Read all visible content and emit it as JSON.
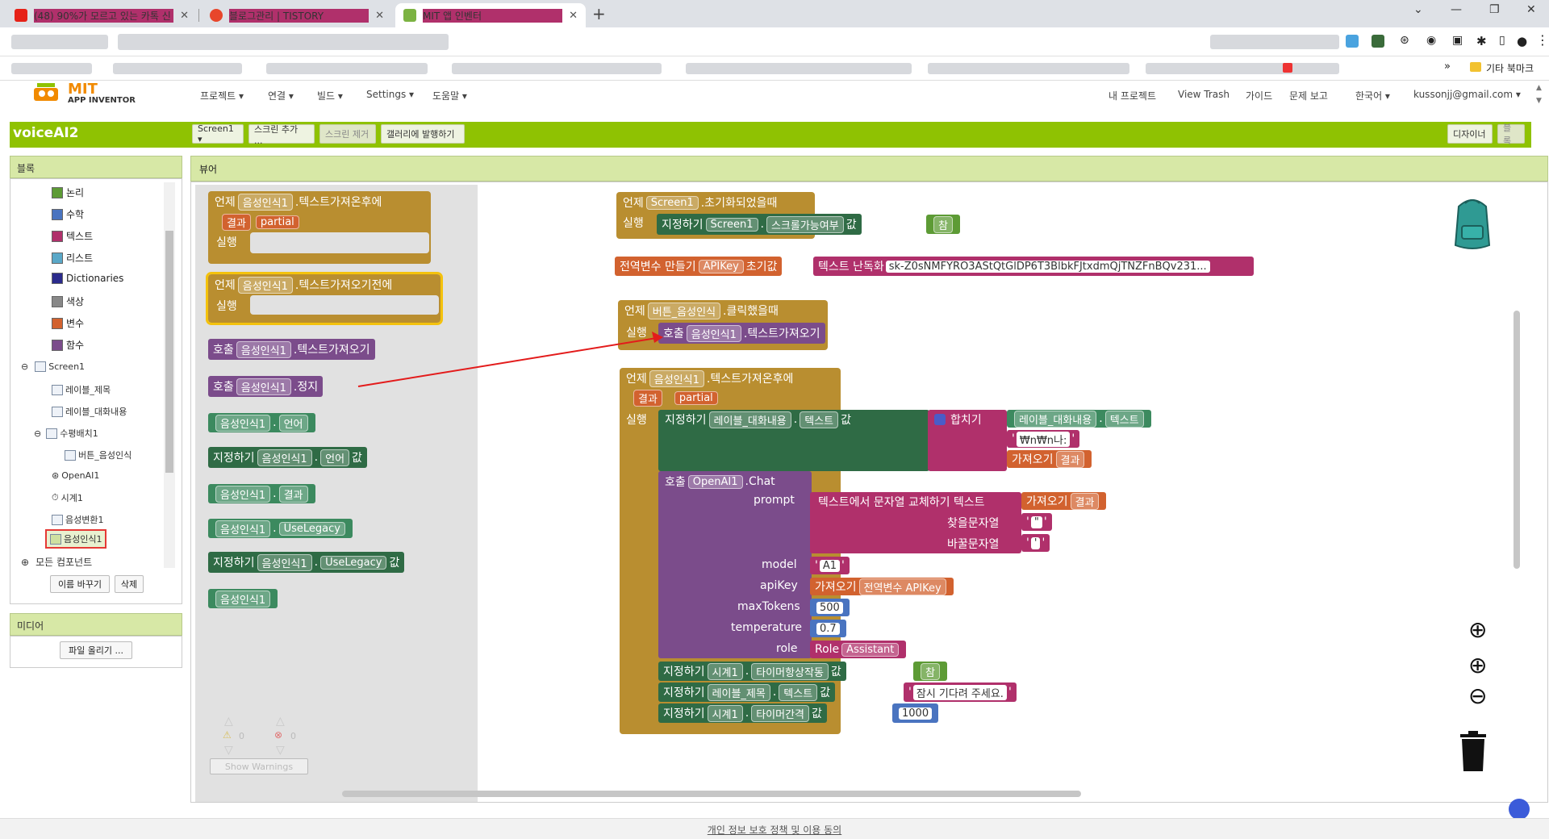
{
  "browser": {
    "tabs": [
      {
        "title": "(48) 90%가 모르고 있는 카톡 신",
        "icon": "youtube-icon"
      },
      {
        "title": "블로그관리 | TISTORY",
        "icon": "tistory-icon"
      },
      {
        "title": "MIT 앱 인벤터",
        "icon": "mit-icon"
      }
    ],
    "bookmarks_other": "기타 북마크",
    "bookmarks_more": "»"
  },
  "app": {
    "logo_line1": "MIT",
    "logo_line2": "APP INVENTOR",
    "menus": [
      "프로젝트 ▾",
      "연결 ▾",
      "빌드 ▾",
      "Settings ▾",
      "도움말 ▾"
    ],
    "right_menus": [
      "내 프로젝트",
      "View Trash",
      "가이드",
      "문제 보고",
      "한국어 ▾",
      "kussonjj@gmail.com ▾"
    ],
    "project_name": "voiceAI2",
    "toolbar": {
      "screen": "Screen1 ▾",
      "add_screen": "스크린 추가 ...",
      "remove_screen": "스크린 제거",
      "publish": "갤러리에 발행하기",
      "designer": "디자이너",
      "blocks": "블록"
    }
  },
  "blocks_panel": {
    "title": "블록",
    "builtins": [
      {
        "label": "논리",
        "color": "#5d9b35"
      },
      {
        "label": "수학",
        "color": "#4a74c0"
      },
      {
        "label": "텍스트",
        "color": "#b0306b"
      },
      {
        "label": "리스트",
        "color": "#5aa8c8"
      },
      {
        "label": "Dictionaries",
        "color": "#2b2b8c"
      },
      {
        "label": "색상",
        "color": "#888888"
      },
      {
        "label": "변수",
        "color": "#d2622f"
      },
      {
        "label": "함수",
        "color": "#7b4c8b"
      }
    ],
    "tree": [
      "Screen1",
      "레이블_제목",
      "레이블_대화내용",
      "수평배치1",
      "버튼_음성인식",
      "OpenAI1",
      "시계1",
      "음성변환1",
      "음성인식1",
      "모든 컴포넌트"
    ],
    "rename": "이름 바꾸기",
    "delete": "삭제"
  },
  "media_panel": {
    "title": "미디어",
    "upload": "파일 올리기 ..."
  },
  "viewer": {
    "title": "뷰어",
    "warnings": {
      "warn_count": "0",
      "error_count": "0",
      "button": "Show Warnings"
    },
    "footer": "개인 정보 보호 정책 및 이용 동의"
  },
  "flyout": {
    "b1": {
      "kw": "언제",
      "comp": "음성인식1",
      "ev": ".텍스트가져온후에",
      "p1": "결과",
      "p2": "partial",
      "do": "실행"
    },
    "b2": {
      "kw": "언제",
      "comp": "음성인식1",
      "ev": ".텍스트가져오기전에",
      "do": "실행"
    },
    "b3": {
      "kw": "호출",
      "comp": "음성인식1",
      "m": ".텍스트가져오기"
    },
    "b4": {
      "kw": "호출",
      "comp": "음성인식1",
      "m": ".정지"
    },
    "b5": {
      "comp": "음성인식1",
      "prop": "언어"
    },
    "b6": {
      "kw": "지정하기",
      "comp": "음성인식1",
      "prop": "언어",
      "val": "값"
    },
    "b7": {
      "comp": "음성인식1",
      "prop": "결과"
    },
    "b8": {
      "comp": "음성인식1",
      "prop": "UseLegacy"
    },
    "b9": {
      "kw": "지정하기",
      "comp": "음성인식1",
      "prop": "UseLegacy",
      "val": "값"
    },
    "b10": {
      "comp": "음성인식1"
    }
  },
  "ws": {
    "init": {
      "kw": "언제",
      "comp": "Screen1",
      "ev": ".초기화되었을때",
      "do": "실행",
      "set": "지정하기",
      "scomp": "Screen1",
      "prop": "스크롤가능여부",
      "val": "값",
      "bool": "참"
    },
    "global": {
      "kw": "전역변수 만들기",
      "name": "APIKey",
      "init": "초기값",
      "obf": "텍스트 난독화",
      "key": "sk-Z0sNMFYRO3AStQtGlDP6T3BlbkFJtxdmQjTNZFnBQv231..."
    },
    "click": {
      "kw": "언제",
      "comp": "버튼_음성인식",
      "ev": ".클릭했을때",
      "do": "실행",
      "call": "호출",
      "ccomp": "음성인식1",
      "m": ".텍스트가져오기"
    },
    "after": {
      "kw": "언제",
      "comp": "음성인식1",
      "ev": ".텍스트가져온후에",
      "p1": "결과",
      "p2": "partial",
      "do": "실행"
    },
    "set1": {
      "kw": "지정하기",
      "comp": "레이블_대화내용",
      "prop": "텍스트",
      "val": "값",
      "join": "합치기",
      "jcomp": "레이블_대화내용",
      "jprop": "텍스트",
      "nl": "₩n₩n나:",
      "get": "가져오기",
      "getv": "결과"
    },
    "chat": {
      "kw": "호출",
      "comp": "OpenAI1",
      "m": ".Chat",
      "prompt": "prompt",
      "replace": "텍스트에서 문자열 교체하기 텍스트",
      "get": "가져오기",
      "getv": "결과",
      "find": "찾을문자열",
      "rep": "바꿀문자열",
      "q1": "\"",
      "q2": "'",
      "model": "model",
      "modelv": "A1",
      "apikey": "apiKey",
      "apiget": "가져오기",
      "apiv": "전역변수 APIKey",
      "maxTokens": "maxTokens",
      "maxv": "500",
      "temperature": "temperature",
      "tempv": "0.7",
      "role": "role",
      "rolekw": "Role",
      "rolev": "Assistant"
    },
    "set2": {
      "kw": "지정하기",
      "comp": "시계1",
      "prop": "타이머항상작동",
      "val": "값",
      "bool": "참"
    },
    "set3": {
      "kw": "지정하기",
      "comp": "레이블_제목",
      "prop": "텍스트",
      "val": "값",
      "str": "잠시 기다려 주세요."
    },
    "set4": {
      "kw": "지정하기",
      "comp": "시계1",
      "prop": "타이머간격",
      "val": "값",
      "num": "1000"
    }
  }
}
